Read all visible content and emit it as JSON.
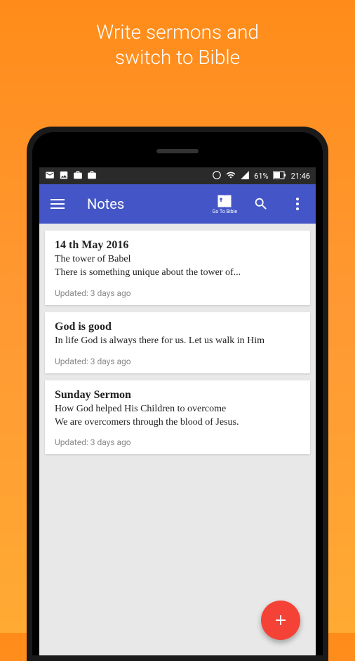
{
  "promo": {
    "line1": "Write sermons and",
    "line2": "switch to Bible"
  },
  "status_bar": {
    "battery_text": "61%",
    "time": "21:46"
  },
  "app_bar": {
    "title": "Notes",
    "bible_label": "Go To Bible"
  },
  "notes": [
    {
      "title": "14 th May 2016",
      "body": "The tower of Babel\nThere is something unique about the tower of...",
      "updated": "Updated: 3 days ago"
    },
    {
      "title": "God is good",
      "body": "In life God is always there for us. Let us walk in Him",
      "updated": "Updated: 3 days ago"
    },
    {
      "title": "Sunday Sermon",
      "body": "How God helped His Children to overcome\nWe are overcomers through the blood of Jesus.",
      "updated": "Updated: 3 days ago"
    }
  ]
}
